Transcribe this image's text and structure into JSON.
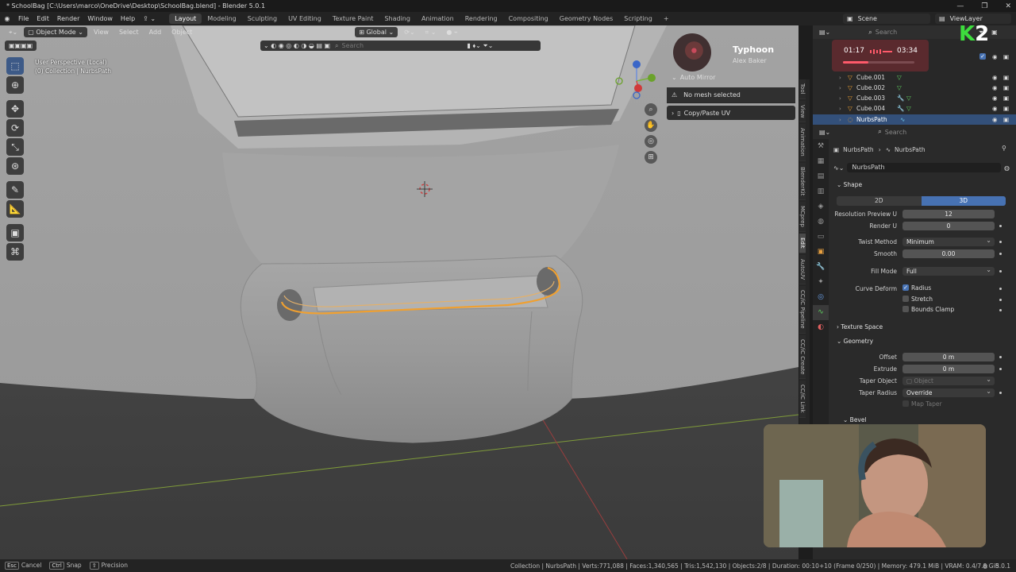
{
  "window": {
    "title": "* SchoolBag [C:\\Users\\marco\\OneDrive\\Desktop\\SchoolBag.blend] - Blender 5.0.1",
    "controls": [
      "—",
      "❐",
      "✕"
    ]
  },
  "menubar": {
    "menus": [
      "File",
      "Edit",
      "Render",
      "Window",
      "Help"
    ],
    "workspaces": [
      "Layout",
      "Modeling",
      "Sculpting",
      "UV Editing",
      "Texture Paint",
      "Shading",
      "Animation",
      "Rendering",
      "Compositing",
      "Geometry Nodes",
      "Scripting"
    ],
    "active_workspace": "Layout",
    "add_tab": "+",
    "scene": "Scene",
    "view_layer": "ViewLayer"
  },
  "viewport_header": {
    "mode": "Object Mode",
    "menus": [
      "View",
      "Select",
      "Add",
      "Object"
    ],
    "transform": "Global",
    "search_placeholder": "Search"
  },
  "viewport": {
    "perspective": "User Perspective (Local)",
    "collection": "(0) Collection | NurbsPath"
  },
  "sidebar_panel": {
    "auto_mirror": "Auto Mirror",
    "warning": "No mesh selected",
    "copy_paste": "Copy/Paste UV"
  },
  "vertical_tabs": [
    "Tool",
    "View",
    "Animation",
    "BlenderKit",
    "MCprep",
    "Edit",
    "AutoUV",
    "CC/iC Pipeline",
    "CC/iC Create",
    "CC/iC Link"
  ],
  "active_vertical_tab": "Edit",
  "music": {
    "song": "Typhoon",
    "artist": "Alex Baker",
    "elapsed": "01:17",
    "total": "03:34",
    "progress": 0.36
  },
  "logo": {
    "k": "K",
    "two": "2"
  },
  "outliner": {
    "search_placeholder": "Search",
    "items": [
      {
        "name": "Cube.001",
        "selected": false
      },
      {
        "name": "Cube.002",
        "selected": false
      },
      {
        "name": "Cube.003",
        "selected": false
      },
      {
        "name": "Cube.004",
        "selected": false
      },
      {
        "name": "NurbsPath",
        "selected": true
      }
    ]
  },
  "properties": {
    "search_placeholder": "Search",
    "breadcrumb_object": "NurbsPath",
    "breadcrumb_data": "NurbsPath",
    "datablock": "NurbsPath",
    "shape": {
      "title": "Shape",
      "mode_2d": "2D",
      "mode_3d": "3D",
      "resolution_preview_label": "Resolution Preview U",
      "resolution_preview": "12",
      "render_u_label": "Render U",
      "render_u": "0",
      "twist_method_label": "Twist Method",
      "twist_method": "Minimum",
      "smooth_label": "Smooth",
      "smooth": "0.00",
      "fill_mode_label": "Fill Mode",
      "fill_mode": "Full",
      "curve_deform_label": "Curve Deform",
      "radius": "Radius",
      "stretch": "Stretch",
      "bounds_clamp": "Bounds Clamp"
    },
    "texture_space": "Texture Space",
    "geometry": {
      "title": "Geometry",
      "offset_label": "Offset",
      "offset": "0 m",
      "extrude_label": "Extrude",
      "extrude": "0 m",
      "taper_object_label": "Taper Object",
      "taper_object_placeholder": "Object",
      "taper_radius_label": "Taper Radius",
      "taper_radius": "Override",
      "map_taper": "Map Taper"
    },
    "bevel": "Bevel"
  },
  "statusbar": {
    "cancel_key": "Esc",
    "cancel": "Cancel",
    "snap_key": "Ctrl",
    "snap": "Snap",
    "precision": "Precision",
    "stats": "Collection | NurbsPath | Verts:771,088 | Faces:1,340,565 | Tris:1,542,130 | Objects:2/8 | Duration: 00:10+10 (Frame 0/250) | Memory: 479.1 MiB | VRAM: 0.4/7.8 GiB",
    "version": "5.0.1"
  },
  "colors": {
    "accent": "#4772b3",
    "selection": "#f0a030",
    "viewport_bg": "#4a4a4a"
  }
}
